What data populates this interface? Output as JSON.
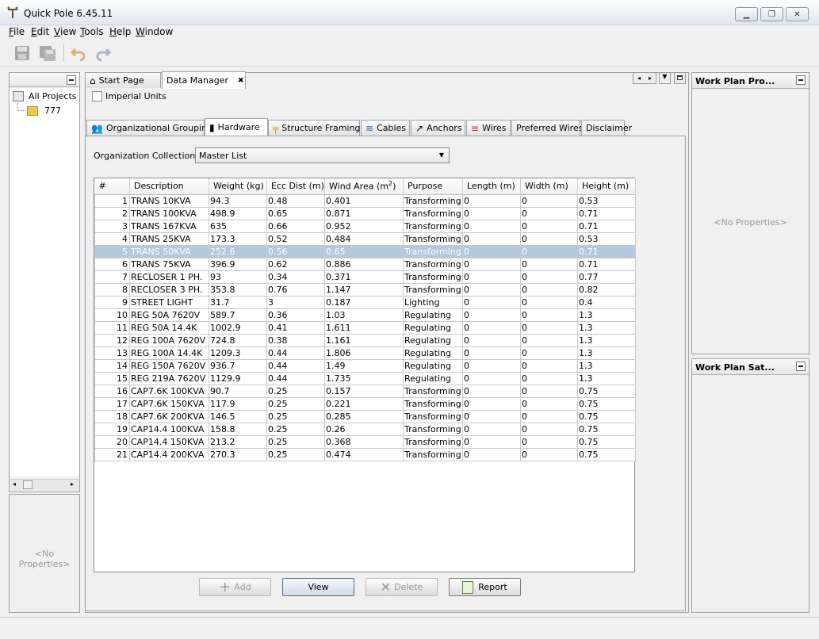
{
  "window": {
    "title": "Quick Pole 6.45.11"
  },
  "menu": [
    "File",
    "Edit",
    "View",
    "Tools",
    "Help",
    "Window"
  ],
  "left_panel": {
    "root": "All Projects",
    "project": "777",
    "no_props": "<No Properties>"
  },
  "tabs": [
    {
      "label": "Start Page"
    },
    {
      "label": "Data Manager"
    }
  ],
  "imperial_units": {
    "label": "Imperial Units",
    "checked": false
  },
  "subtabs": [
    "Organizational Groupings",
    "Hardware",
    "Structure Framing",
    "Cables",
    "Anchors",
    "Wires",
    "Preferred Wires",
    "Disclaimer"
  ],
  "org_collection": {
    "label": "Organization Collection",
    "value": "Master List"
  },
  "table": {
    "headers": [
      "#",
      "Description",
      "Weight (kg)",
      "Ecc Dist (m)",
      "Wind Area (m",
      "Purpose",
      "Length (m)",
      "Width (m)",
      "Height (m)"
    ],
    "wind_sup": "2",
    "wind_close": ")",
    "rows": [
      [
        "1",
        "TRANS 10KVA",
        "94.3",
        "0.48",
        "0.401",
        "Transforming",
        "0",
        "0",
        "0.53"
      ],
      [
        "2",
        "TRANS 100KVA",
        "498.9",
        "0.65",
        "0.871",
        "Transforming",
        "0",
        "0",
        "0.71"
      ],
      [
        "3",
        "TRANS 167KVA",
        "635",
        "0.66",
        "0.952",
        "Transforming",
        "0",
        "0",
        "0.71"
      ],
      [
        "4",
        "TRANS 25KVA",
        "173.3",
        "0.52",
        "0.484",
        "Transforming",
        "0",
        "0",
        "0.53"
      ],
      [
        "5",
        "TRANS 50KVA",
        "252.6",
        "0.56",
        "0.65",
        "Transforming",
        "0",
        "0",
        "0.71"
      ],
      [
        "6",
        "TRANS 75KVA",
        "396.9",
        "0.62",
        "0.886",
        "Transforming",
        "0",
        "0",
        "0.71"
      ],
      [
        "7",
        "RECLOSER 1 PH.",
        "93",
        "0.34",
        "0.371",
        "Transforming",
        "0",
        "0",
        "0.77"
      ],
      [
        "8",
        "RECLOSER 3 PH.",
        "353.8",
        "0.76",
        "1.147",
        "Transforming",
        "0",
        "0",
        "0.82"
      ],
      [
        "9",
        "STREET LIGHT",
        "31.7",
        "3",
        "0.187",
        "Lighting",
        "0",
        "0",
        "0.4"
      ],
      [
        "10",
        "REG 50A 7620V",
        "589.7",
        "0.36",
        "1.03",
        "Regulating",
        "0",
        "0",
        "1.3"
      ],
      [
        "11",
        "REG 50A 14.4K",
        "1002.9",
        "0.41",
        "1.611",
        "Regulating",
        "0",
        "0",
        "1.3"
      ],
      [
        "12",
        "REG 100A 7620V",
        "724.8",
        "0.38",
        "1.161",
        "Regulating",
        "0",
        "0",
        "1.3"
      ],
      [
        "13",
        "REG 100A 14.4K",
        "1209.3",
        "0.44",
        "1.806",
        "Regulating",
        "0",
        "0",
        "1.3"
      ],
      [
        "14",
        "REG 150A 7620V",
        "936.7",
        "0.44",
        "1.49",
        "Regulating",
        "0",
        "0",
        "1.3"
      ],
      [
        "15",
        "REG 219A 7620V",
        "1129.9",
        "0.44",
        "1.735",
        "Regulating",
        "0",
        "0",
        "1.3"
      ],
      [
        "16",
        "CAP7.6K 100KVA",
        "90.7",
        "0.25",
        "0.157",
        "Transforming",
        "0",
        "0",
        "0.75"
      ],
      [
        "17",
        "CAP7.6K 150KVA",
        "117.9",
        "0.25",
        "0.221",
        "Transforming",
        "0",
        "0",
        "0.75"
      ],
      [
        "18",
        "CAP7.6K 200KVA",
        "146.5",
        "0.25",
        "0.285",
        "Transforming",
        "0",
        "0",
        "0.75"
      ],
      [
        "19",
        "CAP14.4 100KVA",
        "158.8",
        "0.25",
        "0.26",
        "Transforming",
        "0",
        "0",
        "0.75"
      ],
      [
        "20",
        "CAP14.4 150KVA",
        "213.2",
        "0.25",
        "0.368",
        "Transforming",
        "0",
        "0",
        "0.75"
      ],
      [
        "21",
        "CAP14.4 200KVA",
        "270.3",
        "0.25",
        "0.474",
        "Transforming",
        "0",
        "0",
        "0.75"
      ]
    ],
    "selected_row": 4
  },
  "buttons": {
    "add": "Add",
    "view": "View",
    "delete": "Delete",
    "report": "Report"
  },
  "right_panel_top": {
    "title": "Work Plan Pro...",
    "no_props": "<No Properties>"
  },
  "right_panel_bottom": {
    "title": "Work Plan Sat..."
  },
  "colors": {
    "selection": "#b3c9e0",
    "titlebar": "#dfe7f1"
  }
}
